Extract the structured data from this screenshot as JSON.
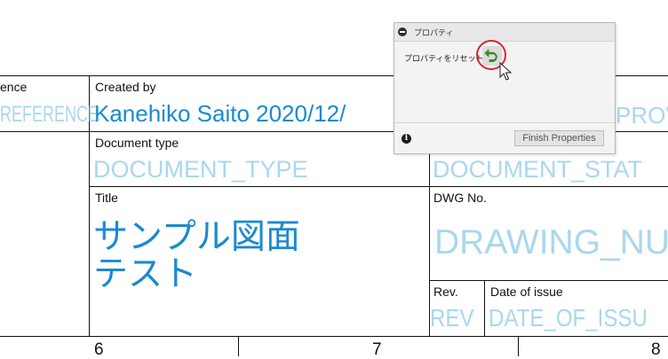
{
  "title_block": {
    "reference_caption": "ence",
    "reference_value": "REFERENCE",
    "created_by_caption": "Created by",
    "created_by_value": "Kanehiko Saito  2020/12/",
    "approved_value": "PROV",
    "document_type_caption": "Document type",
    "document_type_value": "DOCUMENT_TYPE",
    "document_status_value": "DOCUMENT_STAT",
    "title_caption": "Title",
    "title_line1": "サンプル図面",
    "title_line2": "テスト",
    "dwg_no_caption": "DWG No.",
    "dwg_no_value": "DRAWING_NU",
    "rev_caption": "Rev.",
    "rev_value": "REV",
    "date_caption": "Date of issue",
    "date_value": "DATE_OF_ISSU"
  },
  "ruler": {
    "labels": [
      "6",
      "7",
      "8"
    ]
  },
  "properties_panel": {
    "title": "プロパティ",
    "reset_label": "プロパティをリセット",
    "finish_label": "Finish Properties",
    "reset_icon": "reset-arrow-icon",
    "reset_icon_color": "#3a9a2a",
    "highlight_color": "#d8262e"
  }
}
